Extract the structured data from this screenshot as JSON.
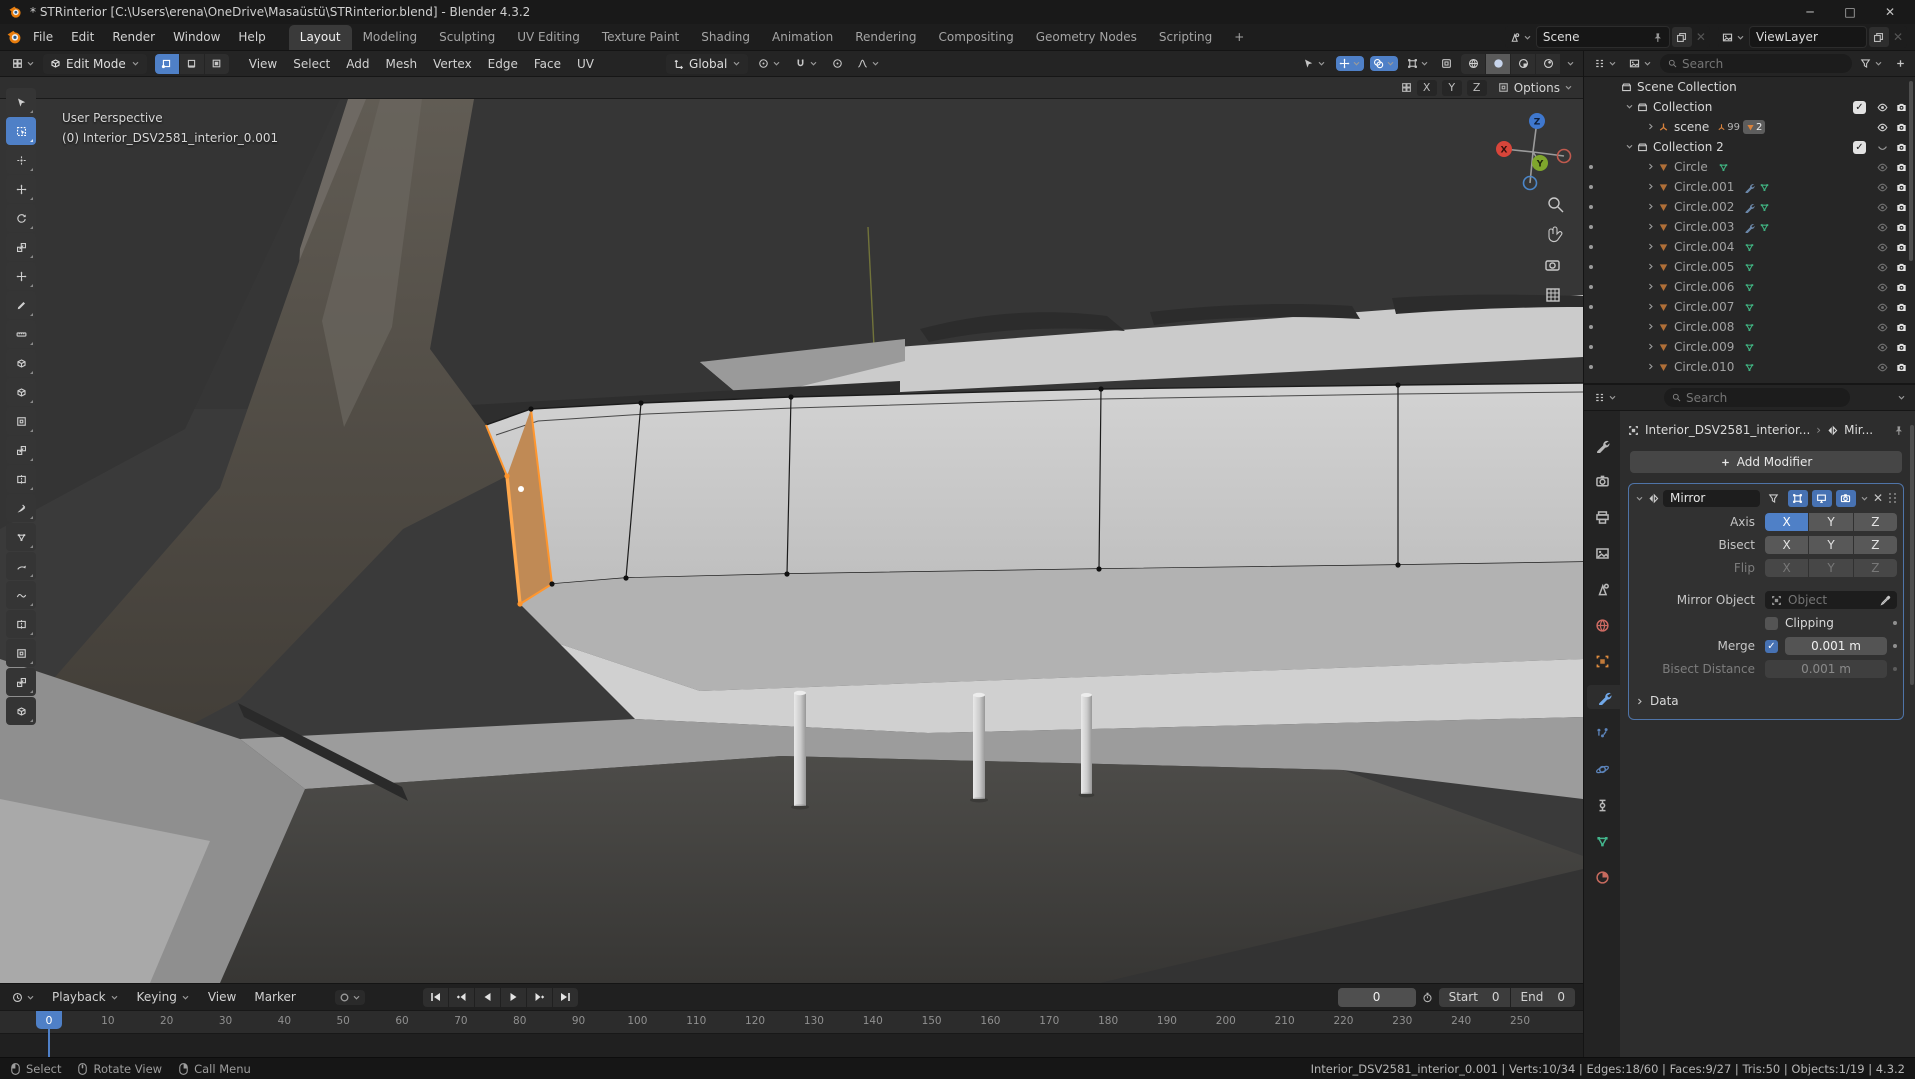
{
  "window": {
    "title": "* STRinterior [C:\\Users\\erena\\OneDrive\\Masaüstü\\STRinterior.blend] - Blender 4.3.2",
    "controls": {
      "minimize": "─",
      "maximize": "□",
      "close": "✕"
    }
  },
  "topbar": {
    "menus": [
      "File",
      "Edit",
      "Render",
      "Window",
      "Help"
    ],
    "tabs": [
      {
        "label": "Layout",
        "active": true
      },
      {
        "label": "Modeling"
      },
      {
        "label": "Sculpting"
      },
      {
        "label": "UV Editing"
      },
      {
        "label": "Texture Paint"
      },
      {
        "label": "Shading"
      },
      {
        "label": "Animation"
      },
      {
        "label": "Rendering"
      },
      {
        "label": "Compositing"
      },
      {
        "label": "Geometry Nodes"
      },
      {
        "label": "Scripting"
      },
      {
        "label": "+"
      }
    ],
    "scene": {
      "label": "Scene"
    },
    "view_layer": {
      "label": "ViewLayer"
    }
  },
  "viewport": {
    "mode": "Edit Mode",
    "menus": [
      "View",
      "Select",
      "Add",
      "Mesh",
      "Vertex",
      "Edge",
      "Face",
      "UV"
    ],
    "orientation": "Global",
    "tool_settings": {
      "axes": [
        "X",
        "Y",
        "Z"
      ],
      "options_label": "Options"
    },
    "overlay_line1": "User Perspective",
    "overlay_line2": "(0) Interior_DSV2581_interior_0.001",
    "gizmo": {
      "x": "X",
      "y": "Y",
      "z": "Z"
    },
    "tools": [
      "tweak",
      "select-box",
      "cursor",
      "move",
      "rotate",
      "scale",
      "transform",
      "annotate",
      "measure",
      "add-cube",
      "extrude-region",
      "inset-faces",
      "bevel",
      "loop-cut",
      "knife",
      "poly-build",
      "spin",
      "smooth",
      "edge-slide",
      "shrink-flatten",
      "shear",
      "rip-region"
    ]
  },
  "outliner": {
    "search_placeholder": "Search",
    "rows": [
      {
        "label": "Scene Collection",
        "icon": "collection",
        "level": 0,
        "disc": "none"
      },
      {
        "label": "Collection",
        "icon": "collection",
        "level": 1,
        "disc": "down",
        "check": true,
        "eye": "bright",
        "cam": true
      },
      {
        "label": "scene",
        "icon": "empty",
        "level": 2,
        "disc": "right",
        "badges": {
          "empties": "99",
          "meshes": "2"
        },
        "eye": "bright",
        "cam": true
      },
      {
        "label": "Collection 2",
        "icon": "collection",
        "level": 1,
        "disc": "down",
        "check": true,
        "eye": "closed",
        "cam": true
      },
      {
        "label": "Circle",
        "icon": "mesh",
        "level": 2,
        "disc": "right",
        "dot": true,
        "mods": [
          "data"
        ],
        "eye": "dim",
        "cam": true
      },
      {
        "label": "Circle.001",
        "icon": "mesh",
        "level": 2,
        "disc": "right",
        "dot": true,
        "mods": [
          "wrench",
          "data"
        ],
        "eye": "dim",
        "cam": true
      },
      {
        "label": "Circle.002",
        "icon": "mesh",
        "level": 2,
        "disc": "right",
        "dot": true,
        "mods": [
          "wrench",
          "data"
        ],
        "eye": "dim",
        "cam": true
      },
      {
        "label": "Circle.003",
        "icon": "mesh",
        "level": 2,
        "disc": "right",
        "dot": true,
        "mods": [
          "wrench",
          "data"
        ],
        "eye": "dim",
        "cam": true
      },
      {
        "label": "Circle.004",
        "icon": "mesh",
        "level": 2,
        "disc": "right",
        "dot": true,
        "mods": [
          "data"
        ],
        "eye": "dim",
        "cam": true
      },
      {
        "label": "Circle.005",
        "icon": "mesh",
        "level": 2,
        "disc": "right",
        "dot": true,
        "mods": [
          "data"
        ],
        "eye": "dim",
        "cam": true
      },
      {
        "label": "Circle.006",
        "icon": "mesh",
        "level": 2,
        "disc": "right",
        "dot": true,
        "mods": [
          "data"
        ],
        "eye": "dim",
        "cam": true
      },
      {
        "label": "Circle.007",
        "icon": "mesh",
        "level": 2,
        "disc": "right",
        "dot": true,
        "mods": [
          "data"
        ],
        "eye": "dim",
        "cam": true
      },
      {
        "label": "Circle.008",
        "icon": "mesh",
        "level": 2,
        "disc": "right",
        "dot": true,
        "mods": [
          "data"
        ],
        "eye": "dim",
        "cam": true
      },
      {
        "label": "Circle.009",
        "icon": "mesh",
        "level": 2,
        "disc": "right",
        "dot": true,
        "mods": [
          "data"
        ],
        "eye": "dim",
        "cam": true
      },
      {
        "label": "Circle.010",
        "icon": "mesh",
        "level": 2,
        "disc": "right",
        "dot": true,
        "mods": [
          "data"
        ],
        "eye": "dim",
        "cam": true
      }
    ]
  },
  "properties": {
    "search_placeholder": "Search",
    "breadcrumb": {
      "object": "Interior_DSV2581_interior...",
      "modifier": "Mir..."
    },
    "add_modifier_label": "Add Modifier",
    "tabs": [
      "tool",
      "render",
      "output",
      "view-layer",
      "scene",
      "world",
      "object",
      "modifiers",
      "particles",
      "physics",
      "constraints",
      "object-data",
      "material"
    ],
    "active_tab": "modifiers",
    "modifier": {
      "name": "Mirror",
      "axis_label": "Axis",
      "bisect_label": "Bisect",
      "flip_label": "Flip",
      "axis_buttons": [
        "X",
        "Y",
        "Z"
      ],
      "axis_active": "X",
      "mirror_object_label": "Mirror Object",
      "mirror_object_placeholder": "Object",
      "clipping_label": "Clipping",
      "clipping_checked": false,
      "merge_label": "Merge",
      "merge_checked": true,
      "merge_value": "0.001 m",
      "bisect_distance_label": "Bisect Distance",
      "bisect_distance_value": "0.001 m",
      "data_label": "Data"
    }
  },
  "timeline": {
    "menus": [
      "Playback",
      "Keying",
      "View",
      "Marker"
    ],
    "transport": [
      "jump-start",
      "prev-keyframe",
      "play-reverse",
      "play",
      "next-keyframe",
      "jump-end"
    ],
    "current_frame": "0",
    "playhead": "0",
    "start_label": "Start",
    "start_value": "0",
    "end_label": "End",
    "end_value": "0",
    "ticks": [
      "10",
      "20",
      "30",
      "40",
      "50",
      "60",
      "70",
      "80",
      "90",
      "100",
      "110",
      "120",
      "130",
      "140",
      "150",
      "160",
      "170",
      "180",
      "190",
      "200",
      "210",
      "220",
      "230",
      "240",
      "250"
    ]
  },
  "statusbar": {
    "items": [
      {
        "icon": "lmb",
        "label": "Select"
      },
      {
        "icon": "mmb",
        "label": "Rotate View"
      },
      {
        "icon": "rmb",
        "label": "Call Menu"
      }
    ],
    "right": "Interior_DSV2581_interior_0.001 | Verts:10/34 | Edges:18/60 | Faces:9/27 | Tris:50 | Objects:1/19 | 4.3.2"
  }
}
